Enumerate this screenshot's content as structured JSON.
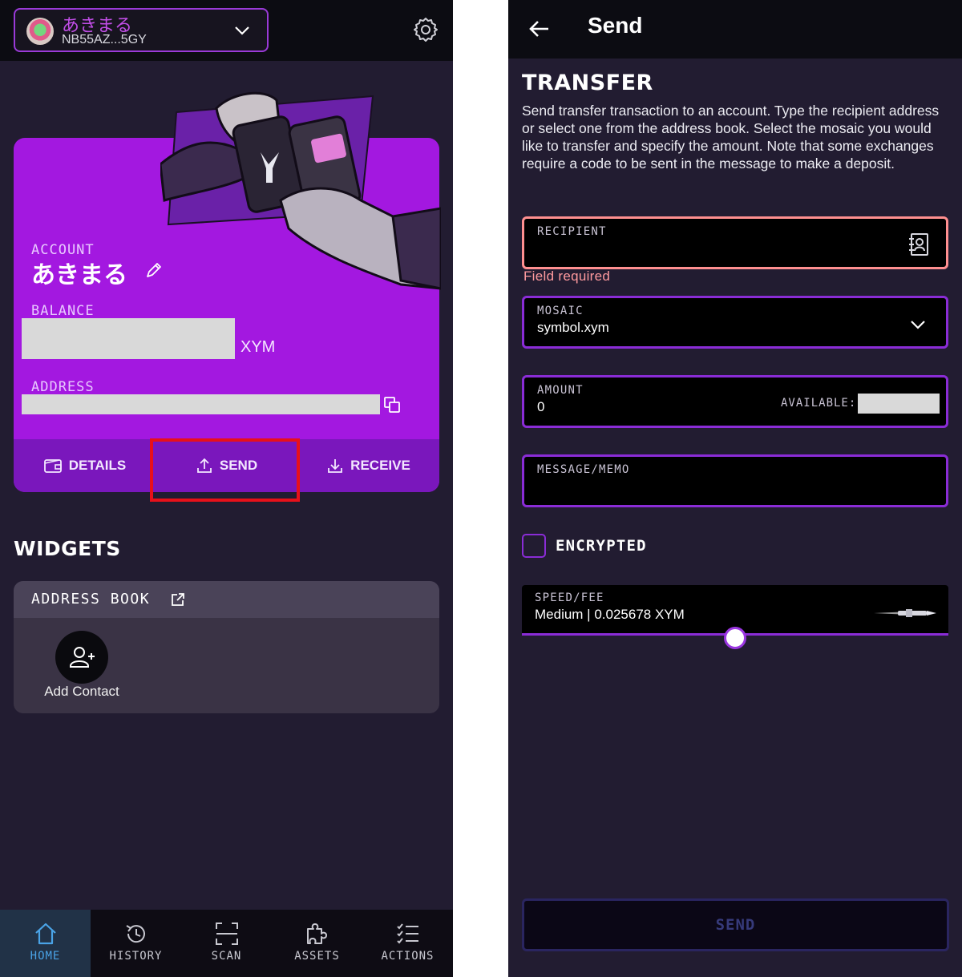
{
  "home": {
    "header": {
      "account_name": "あきまる",
      "account_address": "NB55AZ...5GY"
    },
    "card": {
      "account_label": "ACCOUNT",
      "account_name": "あきまる",
      "balance_label": "BALANCE",
      "balance_unit": "XYM",
      "address_label": "ADDRESS",
      "actions": {
        "details": "DETAILS",
        "send": "SEND",
        "receive": "RECEIVE"
      }
    },
    "widgets": {
      "title": "WIDGETS",
      "address_book": {
        "title": "ADDRESS BOOK",
        "add_contact": "Add Contact"
      }
    },
    "nav": {
      "items": [
        {
          "label": "HOME",
          "icon": "home-icon"
        },
        {
          "label": "HISTORY",
          "icon": "history-icon"
        },
        {
          "label": "SCAN",
          "icon": "scan-icon"
        },
        {
          "label": "ASSETS",
          "icon": "assets-icon"
        },
        {
          "label": "ACTIONS",
          "icon": "actions-icon"
        }
      ]
    }
  },
  "send": {
    "header_title": "Send",
    "section_title": "TRANSFER",
    "description": "Send transfer transaction to an account. Type the recipient address or select one from the address book. Select the mosaic you would like to transfer and specify the amount. Note that some exchanges require a code to be sent in the message to make a deposit.",
    "recipient": {
      "label": "RECIPIENT",
      "value": "",
      "error": "Field required"
    },
    "mosaic": {
      "label": "MOSAIC",
      "value": "symbol.xym"
    },
    "amount": {
      "label": "AMOUNT",
      "value": "0",
      "available_label": "AVAILABLE:"
    },
    "message": {
      "label": "MESSAGE/MEMO",
      "value": ""
    },
    "encrypted": {
      "label": "ENCRYPTED",
      "checked": false
    },
    "fee": {
      "label": "SPEED/FEE",
      "value": "Medium | 0.025678 XYM",
      "level": 0.5
    },
    "submit": "SEND"
  },
  "colors": {
    "accent_purple": "#a318e0",
    "field_border": "#8a2cd6",
    "error": "#ff9a9e",
    "highlight_red": "#e8101a",
    "nav_active": "#4aa3e6"
  }
}
